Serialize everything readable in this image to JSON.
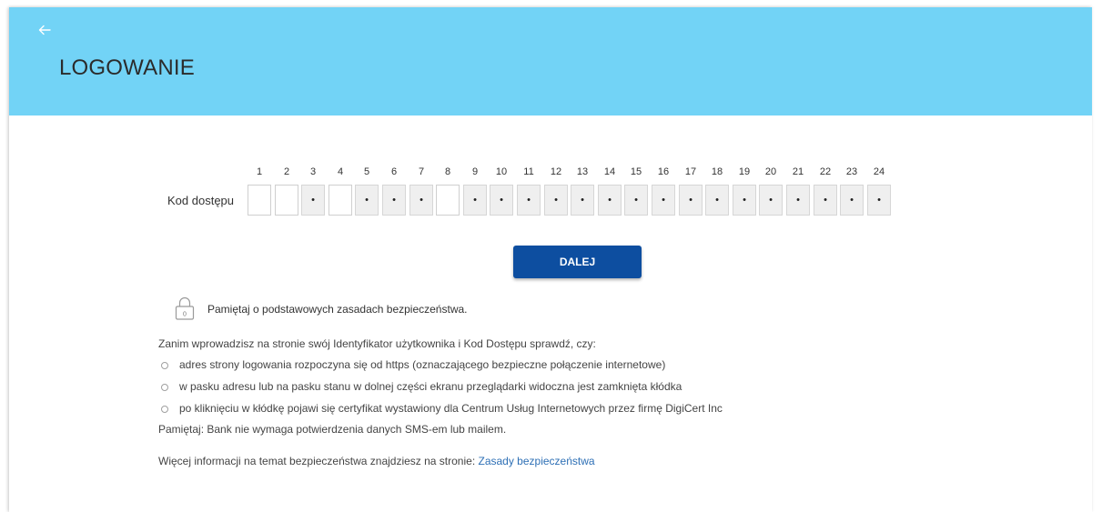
{
  "header": {
    "title": "LOGOWANIE",
    "back_icon": "arrow-left-icon",
    "background_color": "#72d3f6"
  },
  "login": {
    "code_label": "Kod dostępu",
    "positions": [
      {
        "n": "1",
        "enabled": true,
        "value": ""
      },
      {
        "n": "2",
        "enabled": true,
        "value": ""
      },
      {
        "n": "3",
        "enabled": false,
        "value": "•"
      },
      {
        "n": "4",
        "enabled": true,
        "value": ""
      },
      {
        "n": "5",
        "enabled": false,
        "value": "•"
      },
      {
        "n": "6",
        "enabled": false,
        "value": "•"
      },
      {
        "n": "7",
        "enabled": false,
        "value": "•"
      },
      {
        "n": "8",
        "enabled": true,
        "value": ""
      },
      {
        "n": "9",
        "enabled": false,
        "value": "•"
      },
      {
        "n": "10",
        "enabled": false,
        "value": "•"
      },
      {
        "n": "11",
        "enabled": false,
        "value": "•"
      },
      {
        "n": "12",
        "enabled": false,
        "value": "•"
      },
      {
        "n": "13",
        "enabled": false,
        "value": "•"
      },
      {
        "n": "14",
        "enabled": false,
        "value": "•"
      },
      {
        "n": "15",
        "enabled": false,
        "value": "•"
      },
      {
        "n": "16",
        "enabled": false,
        "value": "•"
      },
      {
        "n": "17",
        "enabled": false,
        "value": "•"
      },
      {
        "n": "18",
        "enabled": false,
        "value": "•"
      },
      {
        "n": "19",
        "enabled": false,
        "value": "•"
      },
      {
        "n": "20",
        "enabled": false,
        "value": "•"
      },
      {
        "n": "21",
        "enabled": false,
        "value": "•"
      },
      {
        "n": "22",
        "enabled": false,
        "value": "•"
      },
      {
        "n": "23",
        "enabled": false,
        "value": "•"
      },
      {
        "n": "24",
        "enabled": false,
        "value": "•"
      }
    ],
    "submit_label": "DALEJ",
    "submit_color": "#0d4ea0"
  },
  "security": {
    "lock_icon": "padlock-icon",
    "headline": "Pamiętaj o podstawowych zasadach bezpieczeństwa.",
    "intro": "Zanim wprowadzisz na stronie swój Identyfikator użytkownika i Kod Dostępu sprawdź, czy:",
    "bullets": [
      "adres strony logowania rozpoczyna się od https (oznaczającego bezpieczne połączenie internetowe)",
      "w pasku adresu lub na pasku stanu w dolnej części ekranu przeglądarki widoczna jest zamknięta kłódka",
      "po kliknięciu w kłódkę pojawi się certyfikat wystawiony dla Centrum Usług Internetowych przez firmę DigiCert Inc"
    ],
    "reminder": "Pamiętaj: Bank nie wymaga potwierdzenia danych SMS-em lub mailem.",
    "more_info_text": "Więcej informacji na temat bezpieczeństwa znajdziesz na stronie: ",
    "more_info_link": "Zasady bezpieczeństwa",
    "link_color": "#2d6fb5"
  }
}
